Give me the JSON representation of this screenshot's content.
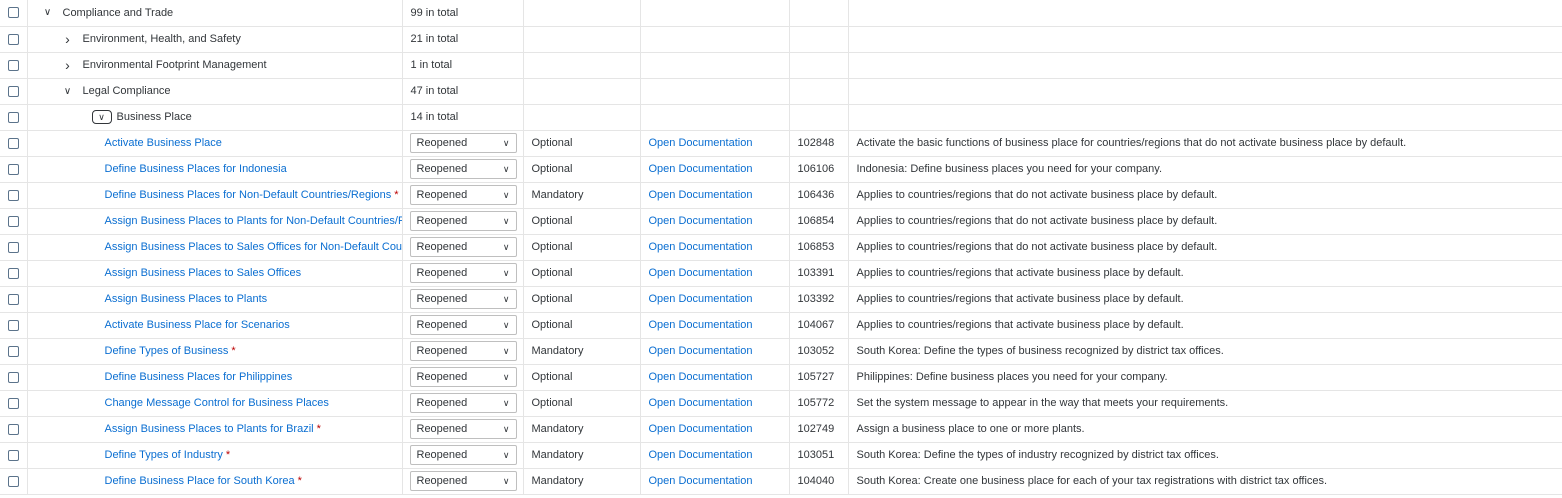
{
  "rows": [
    {
      "kind": "group",
      "level": 0,
      "expanded": true,
      "name": "Compliance and Trade",
      "count": "99 in total"
    },
    {
      "kind": "group",
      "level": 1,
      "expanded": false,
      "name": "Environment, Health, and Safety",
      "count": "21 in total"
    },
    {
      "kind": "group",
      "level": 1,
      "expanded": false,
      "name": "Environmental Footprint Management",
      "count": "1 in total"
    },
    {
      "kind": "group",
      "level": 1,
      "expanded": true,
      "name": "Legal Compliance",
      "count": "47 in total"
    },
    {
      "kind": "group",
      "level": 2,
      "expanded": true,
      "focused": true,
      "name": "Business Place",
      "count": "14 in total"
    },
    {
      "kind": "activity",
      "name": "Activate Business Place",
      "required": false,
      "status": "Reopened",
      "type": "Optional",
      "doc": "Open Documentation",
      "id": "102848",
      "desc": "Activate the basic functions of business place for countries/regions that do not activate business place by default."
    },
    {
      "kind": "activity",
      "name": "Define Business Places for Indonesia",
      "required": false,
      "status": "Reopened",
      "type": "Optional",
      "doc": "Open Documentation",
      "id": "106106",
      "desc": "Indonesia: Define business places you need for your company."
    },
    {
      "kind": "activity",
      "name": "Define Business Places for Non-Default Countries/Regions",
      "required": true,
      "status": "Reopened",
      "type": "Mandatory",
      "doc": "Open Documentation",
      "id": "106436",
      "desc": "Applies to countries/regions that do not activate business place by default."
    },
    {
      "kind": "activity",
      "name": "Assign Business Places to Plants for Non-Default Countries/Regions",
      "required": false,
      "status": "Reopened",
      "type": "Optional",
      "doc": "Open Documentation",
      "id": "106854",
      "desc": "Applies to countries/regions that do not activate business place by default."
    },
    {
      "kind": "activity",
      "name": "Assign Business Places to Sales Offices for Non-Default Countries/Regions",
      "required": false,
      "status": "Reopened",
      "type": "Optional",
      "doc": "Open Documentation",
      "id": "106853",
      "desc": "Applies to countries/regions that do not activate business place by default."
    },
    {
      "kind": "activity",
      "name": "Assign Business Places to Sales Offices",
      "required": false,
      "status": "Reopened",
      "type": "Optional",
      "doc": "Open Documentation",
      "id": "103391",
      "desc": "Applies to countries/regions that activate business place by default."
    },
    {
      "kind": "activity",
      "name": "Assign Business Places to Plants",
      "required": false,
      "status": "Reopened",
      "type": "Optional",
      "doc": "Open Documentation",
      "id": "103392",
      "desc": "Applies to countries/regions that activate business place by default."
    },
    {
      "kind": "activity",
      "name": "Activate Business Place for Scenarios",
      "required": false,
      "status": "Reopened",
      "type": "Optional",
      "doc": "Open Documentation",
      "id": "104067",
      "desc": "Applies to countries/regions that activate business place by default."
    },
    {
      "kind": "activity",
      "name": "Define Types of Business",
      "required": true,
      "status": "Reopened",
      "type": "Mandatory",
      "doc": "Open Documentation",
      "id": "103052",
      "desc": "South Korea: Define the types of business recognized by district tax offices."
    },
    {
      "kind": "activity",
      "name": "Define Business Places for Philippines",
      "required": false,
      "status": "Reopened",
      "type": "Optional",
      "doc": "Open Documentation",
      "id": "105727",
      "desc": "Philippines: Define business places you need for your company."
    },
    {
      "kind": "activity",
      "name": "Change Message Control for Business Places",
      "required": false,
      "status": "Reopened",
      "type": "Optional",
      "doc": "Open Documentation",
      "id": "105772",
      "desc": "Set the system message to appear in the way that meets your requirements."
    },
    {
      "kind": "activity",
      "name": "Assign Business Places to Plants for Brazil",
      "required": true,
      "status": "Reopened",
      "type": "Mandatory",
      "doc": "Open Documentation",
      "id": "102749",
      "desc": "Assign a business place to one or more plants."
    },
    {
      "kind": "activity",
      "name": "Define Types of Industry",
      "required": true,
      "status": "Reopened",
      "type": "Mandatory",
      "doc": "Open Documentation",
      "id": "103051",
      "desc": "South Korea: Define the types of industry recognized by district tax offices."
    },
    {
      "kind": "activity",
      "name": "Define Business Place for South Korea",
      "required": true,
      "status": "Reopened",
      "type": "Mandatory",
      "doc": "Open Documentation",
      "id": "104040",
      "desc": "South Korea: Create one business place for each of your tax registrations with district tax offices."
    }
  ],
  "icons": {
    "expanded": "chevron-down-icon",
    "collapsed": "chevron-right-icon",
    "dropdown": "dropdown-caret-icon"
  },
  "colors": {
    "link": "#0a6ed1",
    "required": "#bb0000",
    "text": "#32363a",
    "border": "#e5e5e5"
  }
}
